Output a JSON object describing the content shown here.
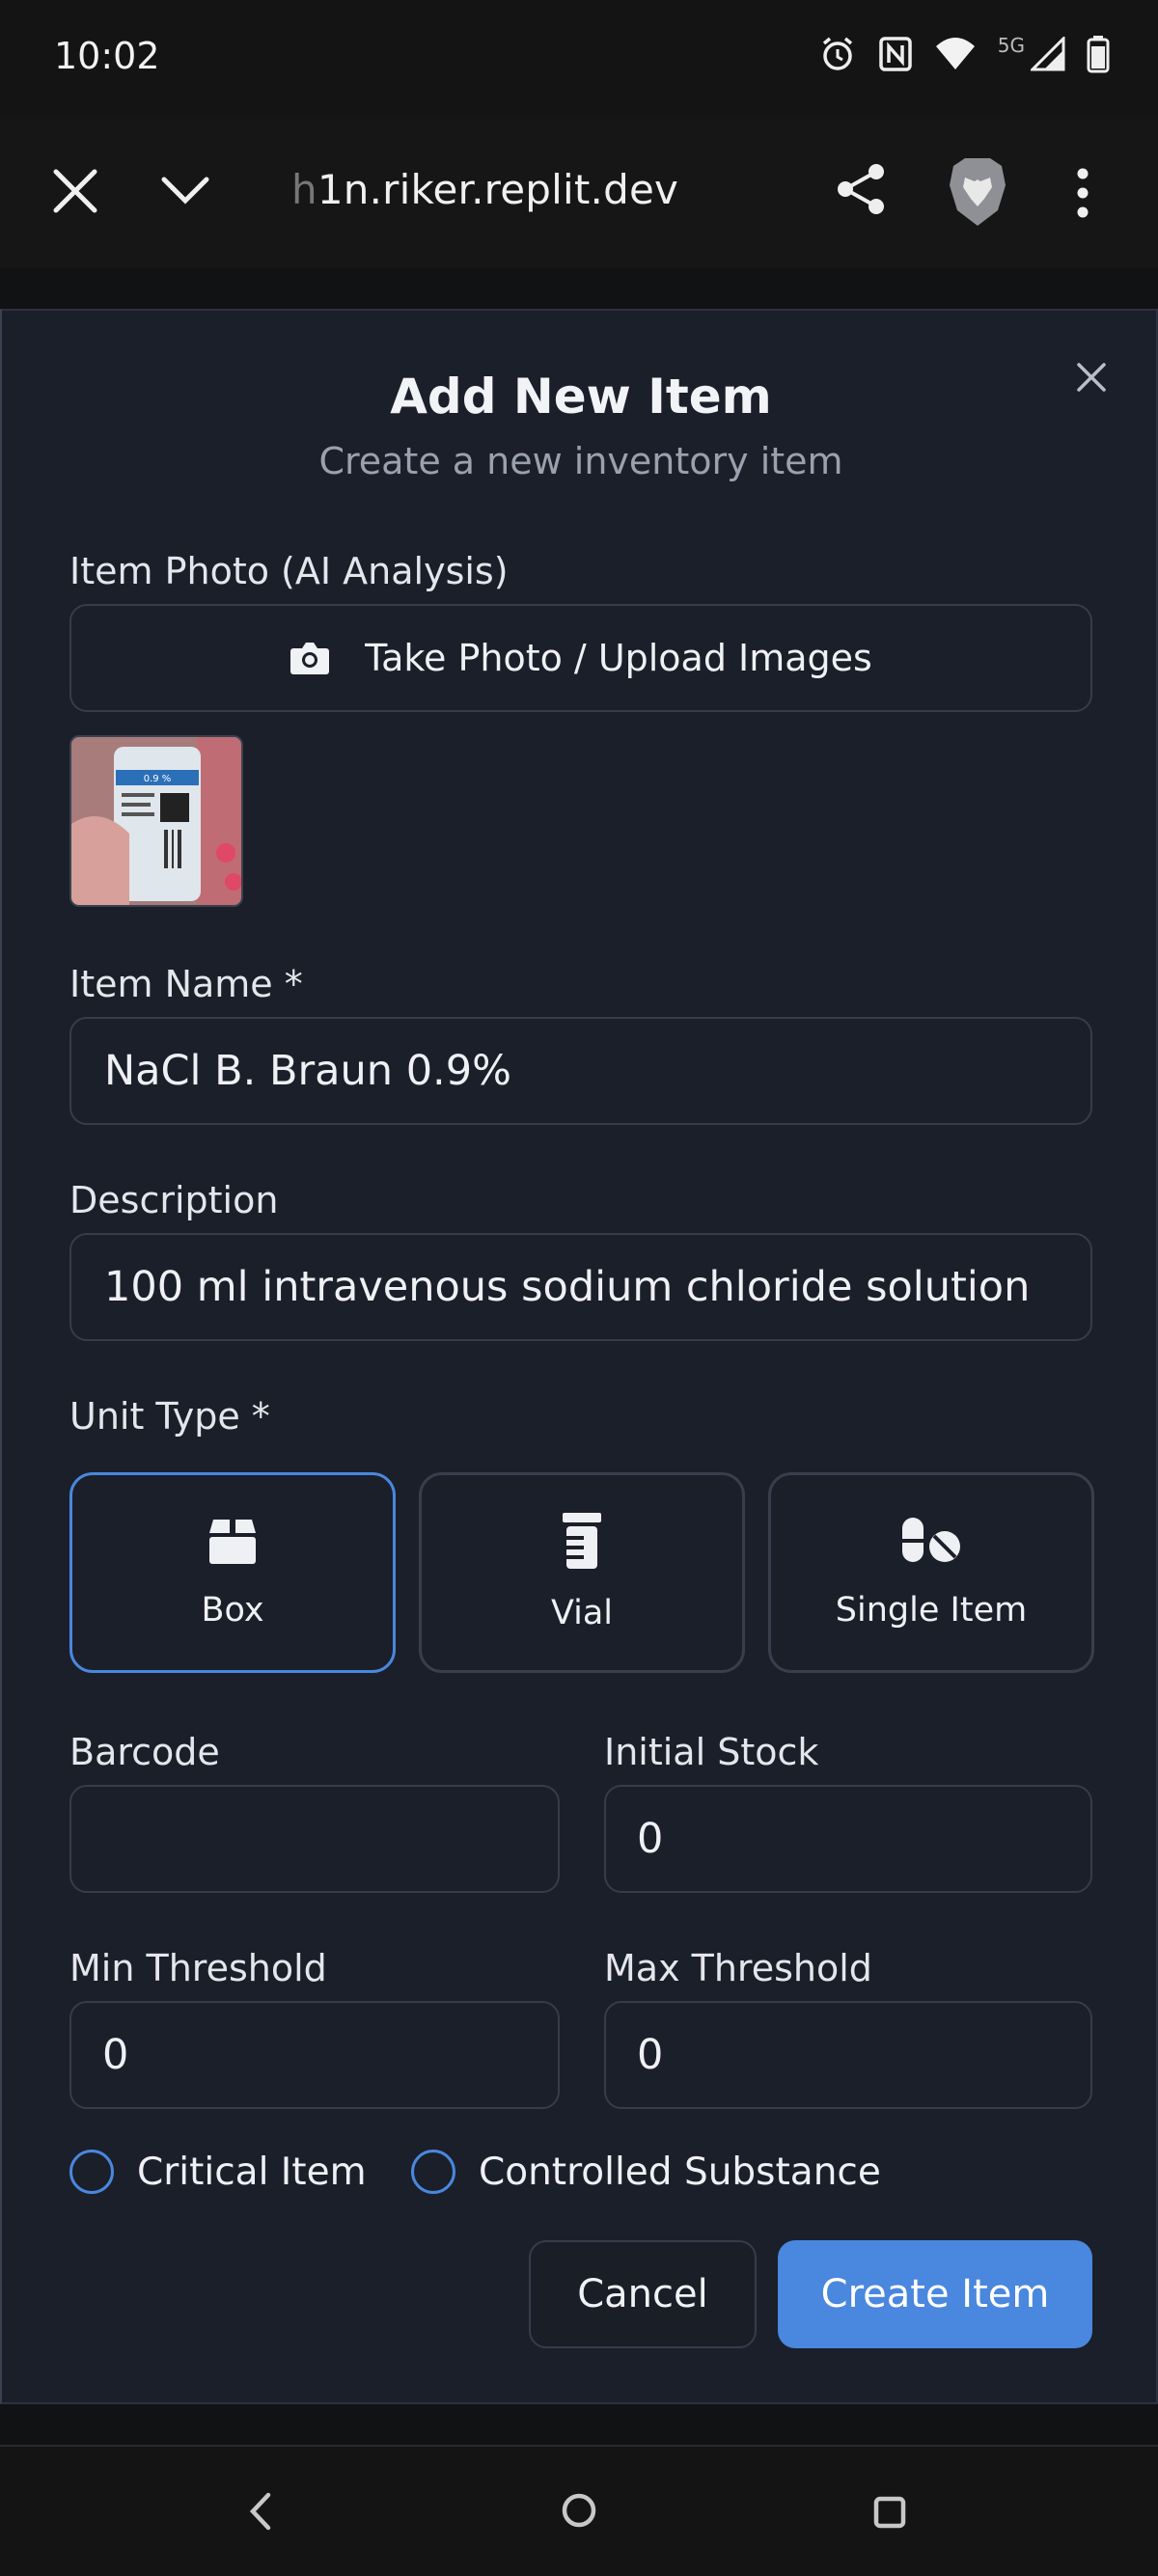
{
  "status_bar": {
    "time": "10:02",
    "network_label": "5G"
  },
  "browser": {
    "url_faded": "h",
    "url_main": "1n.riker.replit.dev"
  },
  "dialog": {
    "title": "Add New Item",
    "subtitle": "Create a new inventory item",
    "photo": {
      "label": "Item Photo (AI Analysis)",
      "button_label": "Take Photo / Upload Images",
      "thumbnail_label": "0.9 %"
    },
    "item_name": {
      "label": "Item Name *",
      "value": "NaCl B. Braun 0.9%"
    },
    "description": {
      "label": "Description",
      "value": "100 ml intravenous sodium chloride solution"
    },
    "unit_type": {
      "label": "Unit Type *",
      "options": [
        {
          "label": "Box",
          "icon": "box-icon",
          "selected": true
        },
        {
          "label": "Vial",
          "icon": "vial-icon",
          "selected": false
        },
        {
          "label": "Single Item",
          "icon": "pills-icon",
          "selected": false
        }
      ]
    },
    "barcode": {
      "label": "Barcode",
      "value": ""
    },
    "initial_stock": {
      "label": "Initial Stock",
      "value": "0"
    },
    "min_threshold": {
      "label": "Min Threshold",
      "value": "0"
    },
    "max_threshold": {
      "label": "Max Threshold",
      "value": "0"
    },
    "critical_item": {
      "label": "Critical Item",
      "checked": false
    },
    "controlled_substance": {
      "label": "Controlled Substance",
      "checked": false
    },
    "cancel_label": "Cancel",
    "create_label": "Create Item"
  },
  "colors": {
    "accent": "#4a87de",
    "dialog_bg": "#1b1f29",
    "border": "#363c4a"
  }
}
